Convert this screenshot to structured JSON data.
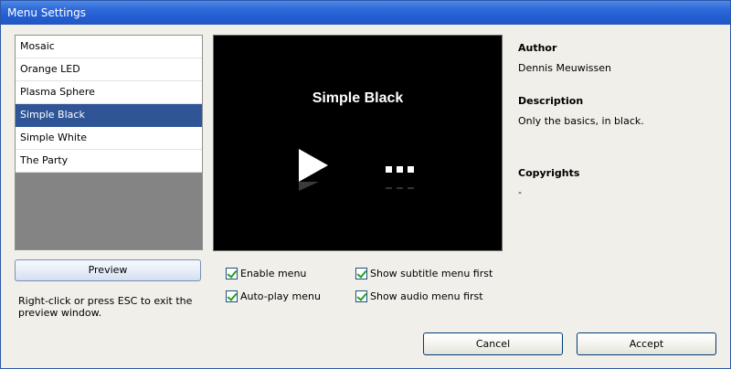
{
  "window": {
    "title": "Menu Settings"
  },
  "skins": {
    "items": [
      {
        "label": "Mosaic",
        "selected": false
      },
      {
        "label": "Orange LED",
        "selected": false
      },
      {
        "label": "Plasma Sphere",
        "selected": false
      },
      {
        "label": "Simple Black",
        "selected": true
      },
      {
        "label": "Simple White",
        "selected": false
      },
      {
        "label": "The Party",
        "selected": false
      }
    ]
  },
  "preview": {
    "title": "Simple Black",
    "icons": [
      "play-icon",
      "more-dots-icon"
    ]
  },
  "info": {
    "author_label": "Author",
    "author_value": "Dennis Meuwissen",
    "description_label": "Description",
    "description_value": "Only the basics, in black.",
    "copyrights_label": "Copyrights",
    "copyrights_value": "-"
  },
  "actions": {
    "preview_label": "Preview",
    "hint": "Right-click or press ESC to exit the preview window.",
    "cancel_label": "Cancel",
    "accept_label": "Accept"
  },
  "options": {
    "enable_menu": {
      "label": "Enable menu",
      "checked": true
    },
    "auto_play_menu": {
      "label": "Auto-play menu",
      "checked": true
    },
    "show_subtitle_menu_first": {
      "label": "Show subtitle menu first",
      "checked": true
    },
    "show_audio_menu_first": {
      "label": "Show audio menu first",
      "checked": true
    }
  },
  "colors": {
    "titlebar": "#2f6ad9",
    "selection": "#2f5597",
    "check": "#21a121",
    "dialog_bg": "#f0efe9"
  }
}
